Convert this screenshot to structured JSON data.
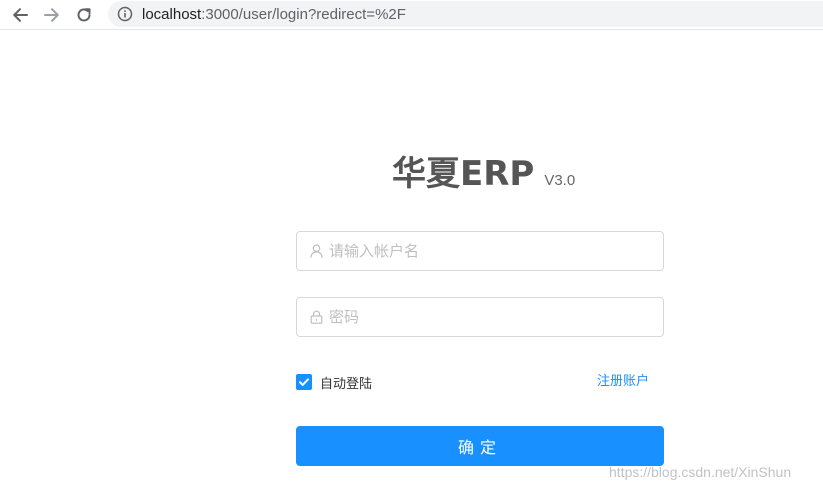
{
  "browser": {
    "url_host": "localhost",
    "url_path": ":3000/user/login?redirect=%2F"
  },
  "logo": {
    "title": "华夏ERP",
    "version": "V3.0"
  },
  "login_form": {
    "username": {
      "placeholder": "请输入帐户名",
      "value": "",
      "icon": "user-icon"
    },
    "password": {
      "placeholder": "密码",
      "value": "",
      "icon": "lock-icon"
    },
    "remember_label": "自动登陆",
    "remember_checked": true,
    "register_link": "注册账户",
    "submit_label": "确定"
  },
  "watermark": "https://blog.csdn.net/XinShun",
  "colors": {
    "primary": "#1890ff",
    "logo_text": "#555555",
    "input_border": "#d9d9d9",
    "placeholder": "#bfbfbf"
  }
}
